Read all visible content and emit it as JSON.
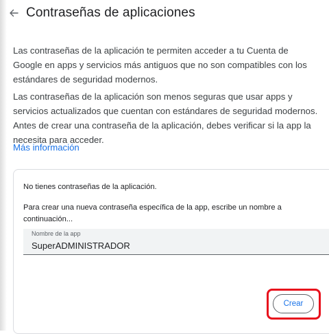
{
  "header": {
    "title": "Contraseñas de aplicaciones",
    "back_icon": "arrow-left-icon"
  },
  "intro": {
    "paragraph1": "Las contraseñas de la aplicación te permiten acceder a tu Cuenta de Google en apps y servicios más antiguos que no son compatibles con los estándares de seguridad modernos.",
    "paragraph2": "Las contraseñas de la aplicación son menos seguras que usar apps y servicios actualizados que cuentan con estándares de seguridad modernos. Antes de crear una contraseña de la aplicación, debes verificar si la app la necesita para acceder.",
    "more_info_link": "Más información"
  },
  "card": {
    "empty_message": "No tienes contraseñas de la aplicación.",
    "instructions": "Para crear una nueva contraseña específica de la app, escribe un nombre a continuación...",
    "app_name_field": {
      "label": "Nombre de la app",
      "value": "SuperADMINISTRADOR"
    },
    "create_button_label": "Crear"
  },
  "colors": {
    "accent": "#1a73e8",
    "highlight": "#e8101c",
    "field_bg": "#f1f3f4"
  }
}
